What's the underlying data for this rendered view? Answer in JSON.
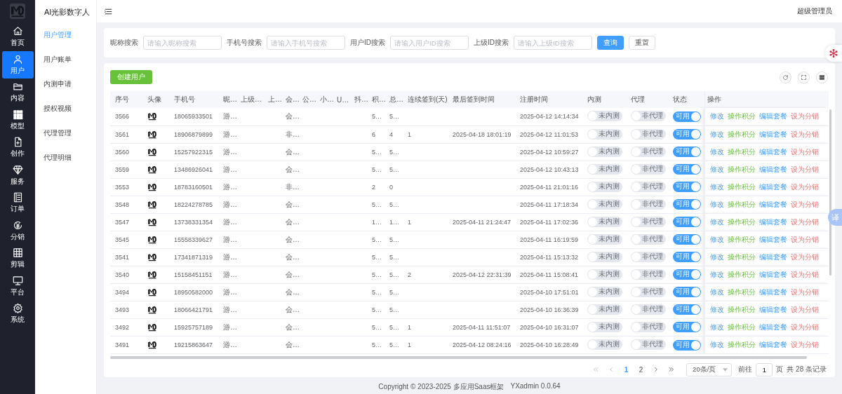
{
  "sidebar": {
    "items": [
      {
        "label": "首页",
        "selected": false
      },
      {
        "label": "用户",
        "selected": true
      },
      {
        "label": "内容",
        "selected": false
      },
      {
        "label": "模型",
        "selected": false
      },
      {
        "label": "创作",
        "selected": false
      },
      {
        "label": "服务",
        "selected": false
      },
      {
        "label": "订单",
        "selected": false
      },
      {
        "label": "分销",
        "selected": false
      },
      {
        "label": "剪辑",
        "selected": false
      },
      {
        "label": "平台",
        "selected": false
      },
      {
        "label": "系统",
        "selected": false
      }
    ]
  },
  "submenu": {
    "title": "AI光影数字人",
    "items": [
      {
        "label": "用户管理",
        "selected": true
      },
      {
        "label": "用户账单",
        "selected": false
      },
      {
        "label": "内测申请",
        "selected": false
      },
      {
        "label": "授权视频",
        "selected": false
      },
      {
        "label": "代理管理",
        "selected": false
      },
      {
        "label": "代理明细",
        "selected": false
      }
    ]
  },
  "header": {
    "user": "超级管理员"
  },
  "search": {
    "fields": [
      {
        "label": "昵称搜索",
        "placeholder": "请输入昵称搜索"
      },
      {
        "label": "手机号搜索",
        "placeholder": "请输入手机号搜索"
      },
      {
        "label": "用户ID搜索",
        "placeholder": "请输入用户ID搜索"
      },
      {
        "label": "上级ID搜索",
        "placeholder": "请输入上级ID搜索"
      }
    ],
    "buttons": [
      {
        "label": "查询",
        "kind": "primary"
      },
      {
        "label": "重置",
        "kind": "default"
      }
    ]
  },
  "toolbar": {
    "create_button": "创建用户"
  },
  "table": {
    "columns": [
      "序号",
      "头像",
      "手机号",
      "昵…",
      "上级…",
      "上…",
      "会…",
      "公…",
      "小…",
      "U…",
      "抖…",
      "积…",
      "总…",
      "连续签到(天)",
      "最后签到时间",
      "注册时间",
      "内测",
      "代理",
      "状态",
      "操作"
    ],
    "rows": [
      {
        "id": "3566",
        "phone": "18065933501",
        "nickname": "游…",
        "member": "会…",
        "points": "5…",
        "total": "5…",
        "streak": "",
        "last_sign": "",
        "registered": "2025-04-12 14:14:34",
        "beta": {
          "label": "未内测",
          "on": false
        },
        "agent": {
          "label": "非代理",
          "on": false
        },
        "status": {
          "label": "可用",
          "on": true
        },
        "actions": [
          {
            "label": "修改",
            "kind": "edit"
          },
          {
            "label": "操作积分",
            "kind": "points"
          },
          {
            "label": "编辑套餐",
            "kind": "edit"
          },
          {
            "label": "设为分销",
            "kind": "danger"
          }
        ]
      },
      {
        "id": "3561",
        "phone": "18906879899",
        "nickname": "游…",
        "member": "非…",
        "points": "6",
        "total": "4",
        "streak": "1",
        "last_sign": "2025-04-18 18:01:19",
        "registered": "2025-04-12 11:01:53",
        "beta": {
          "label": "未内测",
          "on": false
        },
        "agent": {
          "label": "非代理",
          "on": false
        },
        "status": {
          "label": "可用",
          "on": true
        },
        "actions": [
          {
            "label": "修改",
            "kind": "edit"
          },
          {
            "label": "操作积分",
            "kind": "points"
          },
          {
            "label": "编辑套餐",
            "kind": "edit"
          },
          {
            "label": "设为分销",
            "kind": "danger"
          }
        ]
      },
      {
        "id": "3560",
        "phone": "15257922315",
        "nickname": "游…",
        "member": "会…",
        "points": "5…",
        "total": "5…",
        "streak": "",
        "last_sign": "",
        "registered": "2025-04-12 10:59:27",
        "beta": {
          "label": "未内测",
          "on": false
        },
        "agent": {
          "label": "非代理",
          "on": false
        },
        "status": {
          "label": "可用",
          "on": true
        },
        "actions": [
          {
            "label": "修改",
            "kind": "edit"
          },
          {
            "label": "操作积分",
            "kind": "points"
          },
          {
            "label": "编辑套餐",
            "kind": "edit"
          },
          {
            "label": "设为分销",
            "kind": "danger"
          }
        ]
      },
      {
        "id": "3559",
        "phone": "13486926041",
        "nickname": "游…",
        "member": "会…",
        "points": "5…",
        "total": "5…",
        "streak": "",
        "last_sign": "",
        "registered": "2025-04-12 10:43:13",
        "beta": {
          "label": "未内测",
          "on": false
        },
        "agent": {
          "label": "非代理",
          "on": false
        },
        "status": {
          "label": "可用",
          "on": true
        },
        "actions": [
          {
            "label": "修改",
            "kind": "edit"
          },
          {
            "label": "操作积分",
            "kind": "points"
          },
          {
            "label": "编辑套餐",
            "kind": "edit"
          },
          {
            "label": "设为分销",
            "kind": "danger"
          }
        ]
      },
      {
        "id": "3553",
        "phone": "18783160501",
        "nickname": "游…",
        "member": "非…",
        "points": "2",
        "total": "0",
        "streak": "",
        "last_sign": "",
        "registered": "2025-04-11 21:01:16",
        "beta": {
          "label": "未内测",
          "on": false
        },
        "agent": {
          "label": "非代理",
          "on": false
        },
        "status": {
          "label": "可用",
          "on": true
        },
        "actions": [
          {
            "label": "修改",
            "kind": "edit"
          },
          {
            "label": "操作积分",
            "kind": "points"
          },
          {
            "label": "编辑套餐",
            "kind": "edit"
          },
          {
            "label": "设为分销",
            "kind": "danger"
          }
        ]
      },
      {
        "id": "3548",
        "phone": "18224278785",
        "nickname": "游…",
        "member": "会…",
        "points": "5…",
        "total": "5…",
        "streak": "",
        "last_sign": "",
        "registered": "2025-04-11 17:18:34",
        "beta": {
          "label": "未内测",
          "on": false
        },
        "agent": {
          "label": "非代理",
          "on": false
        },
        "status": {
          "label": "可用",
          "on": true
        },
        "actions": [
          {
            "label": "修改",
            "kind": "edit"
          },
          {
            "label": "操作积分",
            "kind": "points"
          },
          {
            "label": "编辑套餐",
            "kind": "edit"
          },
          {
            "label": "设为分销",
            "kind": "danger"
          }
        ]
      },
      {
        "id": "3547",
        "phone": "13738331354",
        "nickname": "游…",
        "member": "会…",
        "points": "1…",
        "total": "1…",
        "streak": "1",
        "last_sign": "2025-04-11 21:24:47",
        "registered": "2025-04-11 17:02:36",
        "beta": {
          "label": "未内测",
          "on": false
        },
        "agent": {
          "label": "非代理",
          "on": false
        },
        "status": {
          "label": "可用",
          "on": true
        },
        "actions": [
          {
            "label": "修改",
            "kind": "edit"
          },
          {
            "label": "操作积分",
            "kind": "points"
          },
          {
            "label": "编辑套餐",
            "kind": "edit"
          },
          {
            "label": "设为分销",
            "kind": "danger"
          }
        ]
      },
      {
        "id": "3545",
        "phone": "15558339627",
        "nickname": "游…",
        "member": "会…",
        "points": "5…",
        "total": "5…",
        "streak": "",
        "last_sign": "",
        "registered": "2025-04-11 16:19:59",
        "beta": {
          "label": "未内测",
          "on": false
        },
        "agent": {
          "label": "非代理",
          "on": false
        },
        "status": {
          "label": "可用",
          "on": true
        },
        "actions": [
          {
            "label": "修改",
            "kind": "edit"
          },
          {
            "label": "操作积分",
            "kind": "points"
          },
          {
            "label": "编辑套餐",
            "kind": "edit"
          },
          {
            "label": "设为分销",
            "kind": "danger"
          }
        ]
      },
      {
        "id": "3541",
        "phone": "17341871319",
        "nickname": "游…",
        "member": "会…",
        "points": "5…",
        "total": "5…",
        "streak": "",
        "last_sign": "",
        "registered": "2025-04-11 15:13:32",
        "beta": {
          "label": "未内测",
          "on": false
        },
        "agent": {
          "label": "非代理",
          "on": false
        },
        "status": {
          "label": "可用",
          "on": true
        },
        "actions": [
          {
            "label": "修改",
            "kind": "edit"
          },
          {
            "label": "操作积分",
            "kind": "points"
          },
          {
            "label": "编辑套餐",
            "kind": "edit"
          },
          {
            "label": "设为分销",
            "kind": "danger"
          }
        ]
      },
      {
        "id": "3540",
        "phone": "15158451151",
        "nickname": "游…",
        "member": "会…",
        "points": "5…",
        "total": "5…",
        "streak": "2",
        "last_sign": "2025-04-12 22:31:39",
        "registered": "2025-04-11 15:08:41",
        "beta": {
          "label": "未内测",
          "on": false
        },
        "agent": {
          "label": "非代理",
          "on": false
        },
        "status": {
          "label": "可用",
          "on": true
        },
        "actions": [
          {
            "label": "修改",
            "kind": "edit"
          },
          {
            "label": "操作积分",
            "kind": "points"
          },
          {
            "label": "编辑套餐",
            "kind": "edit"
          },
          {
            "label": "设为分销",
            "kind": "danger"
          }
        ]
      },
      {
        "id": "3494",
        "phone": "18950582000",
        "nickname": "游…",
        "member": "会…",
        "points": "5…",
        "total": "5…",
        "streak": "",
        "last_sign": "",
        "registered": "2025-04-10 17:51:01",
        "beta": {
          "label": "未内测",
          "on": false
        },
        "agent": {
          "label": "非代理",
          "on": false
        },
        "status": {
          "label": "可用",
          "on": true
        },
        "actions": [
          {
            "label": "修改",
            "kind": "edit"
          },
          {
            "label": "操作积分",
            "kind": "points"
          },
          {
            "label": "编辑套餐",
            "kind": "edit"
          },
          {
            "label": "设为分销",
            "kind": "danger"
          }
        ]
      },
      {
        "id": "3493",
        "phone": "18066421791",
        "nickname": "游…",
        "member": "会…",
        "points": "5…",
        "total": "5…",
        "streak": "",
        "last_sign": "",
        "registered": "2025-04-10 16:36:39",
        "beta": {
          "label": "未内测",
          "on": false
        },
        "agent": {
          "label": "非代理",
          "on": false
        },
        "status": {
          "label": "可用",
          "on": true
        },
        "actions": [
          {
            "label": "修改",
            "kind": "edit"
          },
          {
            "label": "操作积分",
            "kind": "points"
          },
          {
            "label": "编辑套餐",
            "kind": "edit"
          },
          {
            "label": "设为分销",
            "kind": "danger"
          }
        ]
      },
      {
        "id": "3492",
        "phone": "15925757189",
        "nickname": "游…",
        "member": "会…",
        "points": "5…",
        "total": "5…",
        "streak": "1",
        "last_sign": "2025-04-11 11:51:07",
        "registered": "2025-04-10 16:31:07",
        "beta": {
          "label": "未内测",
          "on": false
        },
        "agent": {
          "label": "非代理",
          "on": false
        },
        "status": {
          "label": "可用",
          "on": true
        },
        "actions": [
          {
            "label": "修改",
            "kind": "edit"
          },
          {
            "label": "操作积分",
            "kind": "points"
          },
          {
            "label": "编辑套餐",
            "kind": "edit"
          },
          {
            "label": "设为分销",
            "kind": "danger"
          }
        ]
      },
      {
        "id": "3491",
        "phone": "19215863647",
        "nickname": "游…",
        "member": "会…",
        "points": "5…",
        "total": "5…",
        "streak": "1",
        "last_sign": "2025-04-12 08:24:16",
        "registered": "2025-04-10 16:28:49",
        "beta": {
          "label": "未内测",
          "on": false
        },
        "agent": {
          "label": "非代理",
          "on": false
        },
        "status": {
          "label": "可用",
          "on": true
        },
        "actions": [
          {
            "label": "修改",
            "kind": "edit"
          },
          {
            "label": "操作积分",
            "kind": "points"
          },
          {
            "label": "编辑套餐",
            "kind": "edit"
          },
          {
            "label": "设为分销",
            "kind": "danger"
          }
        ]
      }
    ]
  },
  "pagination": {
    "pages": [
      {
        "label": "1",
        "selected": true
      },
      {
        "label": "2",
        "selected": false
      }
    ],
    "page_size": "20条/页",
    "goto_label": "前往",
    "goto_value": "1",
    "page_unit": "页",
    "total": "共 28 条记录"
  },
  "footer": {
    "text": "Copyright © 2023-2025 多应用Saas框架",
    "version": "YXadmin 0.0.64"
  },
  "floating": {
    "translate_label": "译"
  }
}
